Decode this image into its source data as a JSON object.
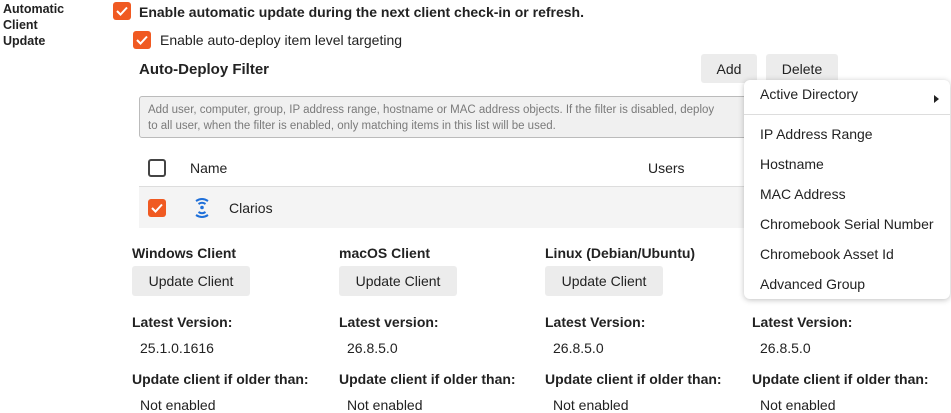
{
  "section": {
    "label_line1": "Automatic",
    "label_line2": "Client",
    "label_line3": "Update"
  },
  "enable_update": {
    "label": "Enable automatic update during the next client check-in or refresh."
  },
  "auto_deploy": {
    "label": "Enable auto-deploy item level targeting"
  },
  "filter": {
    "title": "Auto-Deploy Filter",
    "add_label": "Add",
    "delete_label": "Delete",
    "hint_line1": "Add user, computer, group, IP address range, hostname or MAC address objects. If the filter is disabled, deploy",
    "hint_line2": "to all user, when the filter is enabled, only matching items in this list will be used.",
    "columns": {
      "name": "Name",
      "users": "Users"
    },
    "rows": [
      {
        "name": "Clarios",
        "icon": "network-icon",
        "checked": true
      }
    ]
  },
  "clients": [
    {
      "title": "Windows Client",
      "button": "Update Client",
      "latest_label": "Latest Version:",
      "latest_value": "25.1.0.1616",
      "older_label": "Update client if older than:",
      "older_value": "Not enabled"
    },
    {
      "title": "macOS Client",
      "button": "Update Client",
      "latest_label": "Latest version:",
      "latest_value": "26.8.5.0",
      "older_label": "Update client if older than:",
      "older_value": "Not enabled"
    },
    {
      "title": "Linux (Debian/Ubuntu)",
      "button": "Update Client",
      "latest_label": "Latest Version:",
      "latest_value": "26.8.5.0",
      "older_label": "Update client if older than:",
      "older_value": "Not enabled"
    },
    {
      "title": "",
      "button": "",
      "latest_label": "Latest Version:",
      "latest_value": "26.8.5.0",
      "older_label": "Update client if older than:",
      "older_value": "Not enabled"
    }
  ],
  "menu": {
    "items": [
      {
        "label": "Active Directory",
        "has_submenu": true
      },
      {
        "label": "IP Address Range"
      },
      {
        "label": "Hostname"
      },
      {
        "label": "MAC Address"
      },
      {
        "label": "Chromebook Serial Number"
      },
      {
        "label": "Chromebook Asset Id"
      },
      {
        "label": "Advanced Group"
      }
    ]
  },
  "colors": {
    "accent": "#f05a22",
    "network_icon": "#1e6fd9"
  }
}
